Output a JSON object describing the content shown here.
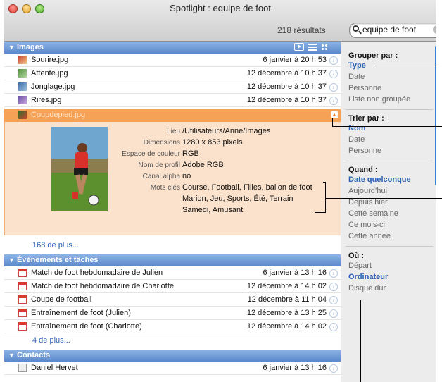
{
  "window": {
    "title": "Spotlight : equipe de foot",
    "result_count": "218 résultats",
    "search": {
      "value": "equipe de foot",
      "placeholder": ""
    }
  },
  "sections": {
    "images": {
      "label": "Images",
      "rows": [
        {
          "name": "Sourire.jpg",
          "date": "6 janvier à 20 h 53"
        },
        {
          "name": "Attente.jpg",
          "date": "12 décembre à 10 h 37"
        },
        {
          "name": "Jonglage.jpg",
          "date": "12 décembre à 10 h 37"
        },
        {
          "name": "Rires.jpg",
          "date": "12 décembre à 10 h 37"
        }
      ],
      "selected": {
        "name": "Coupdepied.jpg"
      },
      "metadata": [
        {
          "key": "Lieu",
          "value": "/Utilisateurs/Anne/Images"
        },
        {
          "key": "Dimensions",
          "value": "1280 x 853 pixels"
        },
        {
          "key": "Espace de couleur",
          "value": "RGB"
        },
        {
          "key": "Nom de profil",
          "value": "Adobe RGB"
        },
        {
          "key": "Canal alpha",
          "value": "no"
        },
        {
          "key": "Mots clés",
          "value": "Course, Football, Filles, ballon de foot"
        }
      ],
      "keywords_more": [
        "Marion, Jeu, Sports, Été, Terrain",
        "Samedi, Amusant"
      ],
      "more": "168 de plus..."
    },
    "events": {
      "label": "Événements et tâches",
      "rows": [
        {
          "name": "Match de foot hebdomadaire de Julien",
          "date": "6 janvier à 13 h 16"
        },
        {
          "name": "Match de foot hebdomadaire de Charlotte",
          "date": "12 décembre à 14 h 02"
        },
        {
          "name": "Coupe de football",
          "date": "12 décembre à 11 h 04"
        },
        {
          "name": "Entraînement de foot (Julien)",
          "date": "12 décembre à 13 h 25"
        },
        {
          "name": "Entraînement de foot (Charlotte)",
          "date": "12 décembre à 14 h 02"
        }
      ],
      "more": "4 de plus..."
    },
    "contacts": {
      "label": "Contacts",
      "rows": [
        {
          "name": "Daniel Hervet",
          "date": "6 janvier à 13 h 16"
        }
      ]
    }
  },
  "sidebar": {
    "group": {
      "title": "Grouper par :",
      "items": [
        "Type",
        "Date",
        "Personne",
        "Liste non groupée"
      ]
    },
    "sort": {
      "title": "Trier par :",
      "items": [
        "Nom",
        "Date",
        "Personne"
      ]
    },
    "when": {
      "title": "Quand :",
      "items": [
        "Date quelconque",
        "Aujourd’hui",
        "Depuis hier",
        "Cette semaine",
        "Ce mois-ci",
        "Cette année"
      ]
    },
    "where": {
      "title": "Où :",
      "items": [
        "Départ",
        "Ordinateur",
        "Disque dur"
      ]
    }
  }
}
